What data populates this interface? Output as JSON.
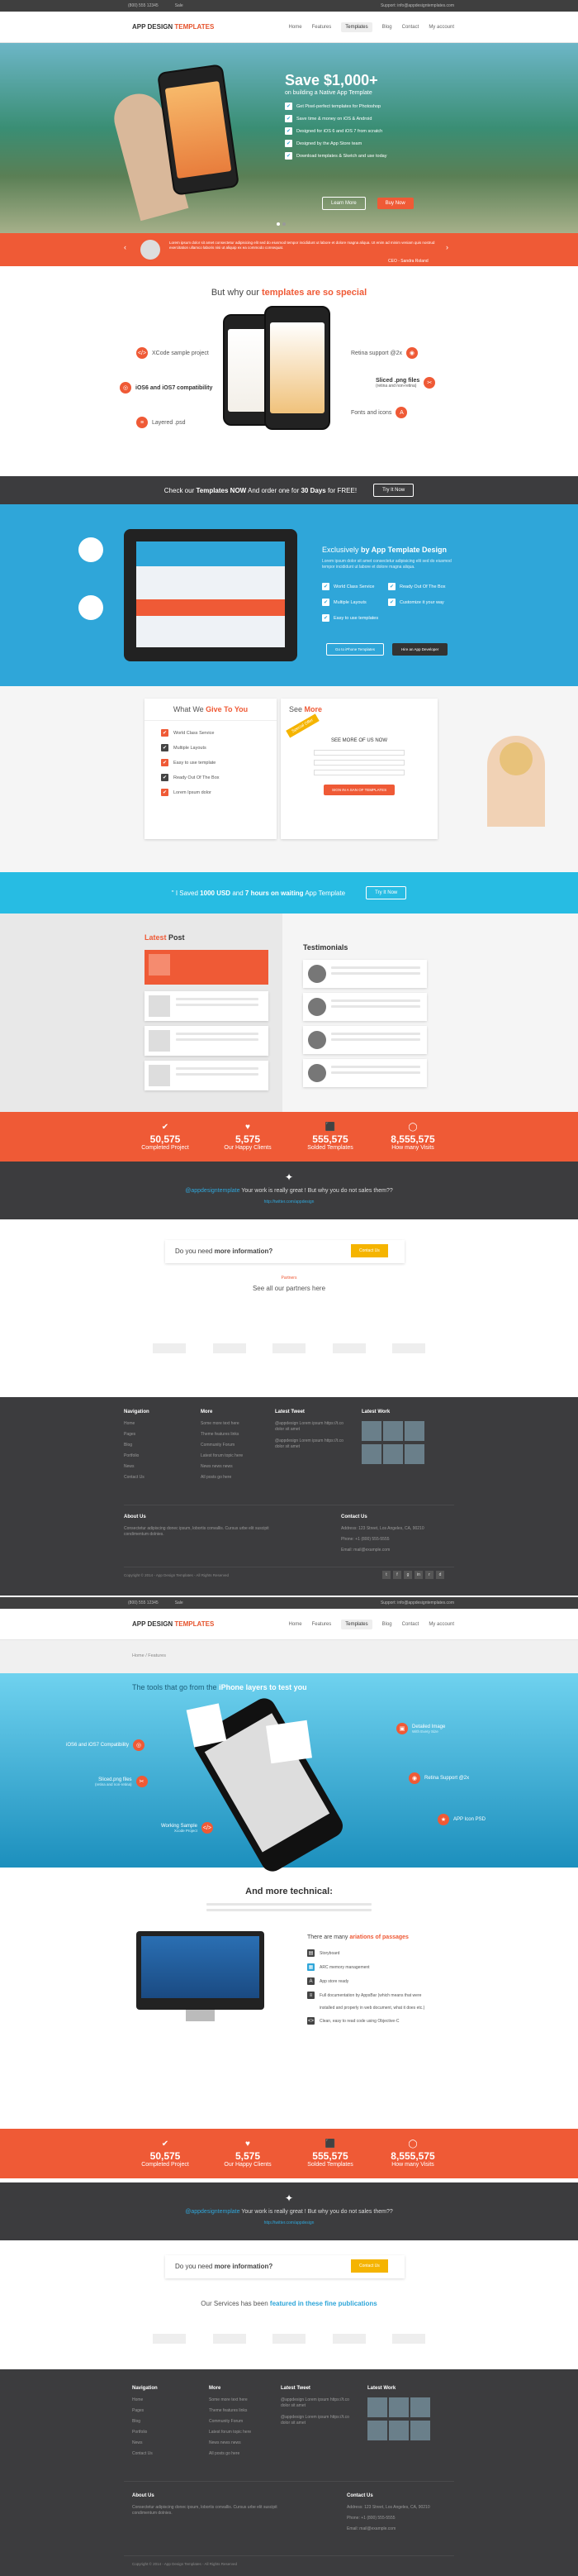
{
  "topbar": {
    "phone": "(800) 555 12345",
    "email_label": "Sale",
    "support": "Support: info@appdesigntemplates.com"
  },
  "header": {
    "logo_a": "APP DESIGN ",
    "logo_b": "TEMPLATES",
    "nav": [
      "Home",
      "Features",
      "Templates",
      "Blog",
      "Contact",
      "My account"
    ]
  },
  "hero": {
    "save": "Save $1,000+",
    "sub": "on building a Native App Template",
    "bullets": [
      "Get Pixel-perfect templates for Photoshop",
      "Save time & money on iOS & Android",
      "Designed for iOS 6 and iOS 7 from scratch",
      "Designed by the App Store team",
      "Download templates & Sketch and use today"
    ],
    "btn1": "Learn More",
    "btn2": "Buy Now",
    "testimonial": "Lorem ipsum dolor sit amet consectetur adipisicing elit sed do eiusmod tempor incididunt ut labore et dolore magna aliqua. Ut enim ad minim veniam quis nostrud exercitation ullamco laboris nisi ut aliquip ex ea commodo consequat.",
    "author": "CEO - Sandra Roland"
  },
  "special": {
    "title_a": "But why our ",
    "title_b": "templates are so special",
    "left": [
      "XCode sample project",
      "iOS6 and iOS7 compatibility",
      "Layered .psd"
    ],
    "right": [
      "Retina support @2x",
      "Sliced .png files",
      "Fonts and icons"
    ],
    "right_sub": "(retina and non-retina)"
  },
  "cta1": {
    "text_a": "Check our ",
    "text_b": "Templates NOW",
    "text_c": " And order one for ",
    "text_d": "30 Days",
    "text_e": " for FREE!",
    "btn": "Try It Now"
  },
  "exclusive": {
    "title_a": "Exclusively ",
    "title_b": "by App Template Design",
    "desc": "Lorem ipsum dolor sit amet consectetur adipisicing elit sed do eiusmod tempor incididunt ut labore et dolore magna aliqua.",
    "checks": [
      "World Class Service",
      "Ready Out Of The Box",
      "Multiple Layouts",
      "Customize it your way",
      "Easy to use templates"
    ],
    "btn1": "Go to iPhone Templates",
    "btn2": "Hire an App Developer"
  },
  "give": {
    "title_a": "What We ",
    "title_b": "Give To You",
    "items": [
      "World Class Service",
      "Multiple Layouts",
      "Easy to use template",
      "Ready Out Of The Box",
      "Lorem Ipsum dolor"
    ],
    "see_a": "See ",
    "see_b": "More",
    "see_head": "SEE MORE OF US NOW",
    "see_btn": "SIGN IN A SAN OF TEMPLATES",
    "ribbon": "Special Offer"
  },
  "cta2": {
    "text": "\" I Saved ",
    "b1": "1000 USD",
    "mid": " and ",
    "b2": "7 hours on waiting",
    "end": " App Template",
    "btn": "Try It Now"
  },
  "latest": {
    "title_a": "Latest ",
    "title_b": "Post",
    "testi": "Testimonials"
  },
  "stats": [
    {
      "n": "50,575",
      "l": "Completed Project",
      "icon": "✔"
    },
    {
      "n": "5,575",
      "l": "Our Happy Clients",
      "icon": "♥"
    },
    {
      "n": "555,575",
      "l": "Solded Templates",
      "icon": "⬛"
    },
    {
      "n": "8,555,575",
      "l": "How many Visits",
      "icon": "◯"
    }
  ],
  "tweet": {
    "handle": "@appdesigntemplate",
    "text": " Your work is really great ! But why you do not sales them??",
    "link": "http://twitter.com/appdesign"
  },
  "info": {
    "text_a": "Do you need ",
    "text_b": "more information?",
    "btn": "Contact Us"
  },
  "partners": {
    "small": "Partners",
    "title": "See all our partners here"
  },
  "footer": {
    "nav_title": "Navigation",
    "nav": [
      "Home",
      "Pages",
      "Blog",
      "Portfolio",
      "News",
      "Contact Us"
    ],
    "more_title": "More",
    "more": [
      "Some more text here",
      "Theme features links",
      "Community Forum",
      "Latest forum topic here",
      "News news news",
      "All posts go here"
    ],
    "tweets_title": "Latest Tweet",
    "tweets": [
      "@appdesign Lorem ipsum https://t.co dolor sit amet",
      "@appdesign Lorem ipsum https://t.co dolor sit amet"
    ],
    "work_title": "Latest Work",
    "about_title": "About Us",
    "about": "Consectetur adipiscing donec ipsum, lobortis convallis. Cursus urbe elit suscipit condimentum dolnies.",
    "contact_title": "Contact Us",
    "contact": [
      "Address: 123 Street, Los Angeles, CA, 90210",
      "Phone: +1 (800) 555-5555",
      "Email: mail@example.com"
    ],
    "copy": "Copyright © 2014 - App Design Templates - All Rights Reserved"
  },
  "page2": {
    "crumb": "Home / Features",
    "hero_title_a": "The tools that go from the ",
    "hero_title_b": "iPhone layers to test you",
    "labels_left": [
      "iOS6 and iOS7 Compatibility",
      "Sliced.png files",
      "Working Sample"
    ],
    "labels_left_sub": [
      "",
      "(retina and non-retina)",
      "Xcode Project"
    ],
    "labels_right": [
      "Detailed Image",
      "Retina Support @2x",
      "APP Icon PSD"
    ],
    "labels_right_sub": [
      "With Every Size",
      "",
      ""
    ],
    "tech_title": "And more technical:",
    "tech_head_a": "There are many ",
    "tech_head_b": "ariations of passages",
    "tech_items": [
      "Storyboard",
      "ARC memory management",
      "App store ready",
      "Full documentation by AppsBar (which means that were",
      "installed and properly in web document, what it does etc.)",
      "Clean, easy to read code using Objective-C"
    ],
    "featured_a": "Our Services has been ",
    "featured_b": "featured in these fine publications"
  }
}
